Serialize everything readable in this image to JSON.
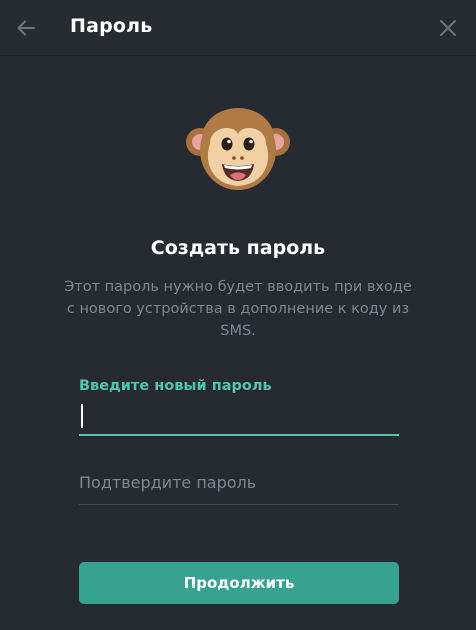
{
  "header": {
    "title": "Пароль",
    "back_icon": "arrow-left-icon",
    "close_icon": "close-icon"
  },
  "illustration": {
    "icon": "monkey-icon"
  },
  "main": {
    "heading": "Создать пароль",
    "description": "Этот пароль нужно будет вводить при входе с нового устройства в дополнение к коду из SMS."
  },
  "form": {
    "new_password": {
      "label": "Введите новый пароль",
      "value": ""
    },
    "confirm_password": {
      "placeholder": "Подтвердите пароль",
      "value": ""
    }
  },
  "actions": {
    "continue_label": "Продолжить"
  },
  "colors": {
    "background": "#262b31",
    "accent": "#4fc5b2",
    "button": "#37a38f",
    "muted_text": "#7d8893"
  }
}
